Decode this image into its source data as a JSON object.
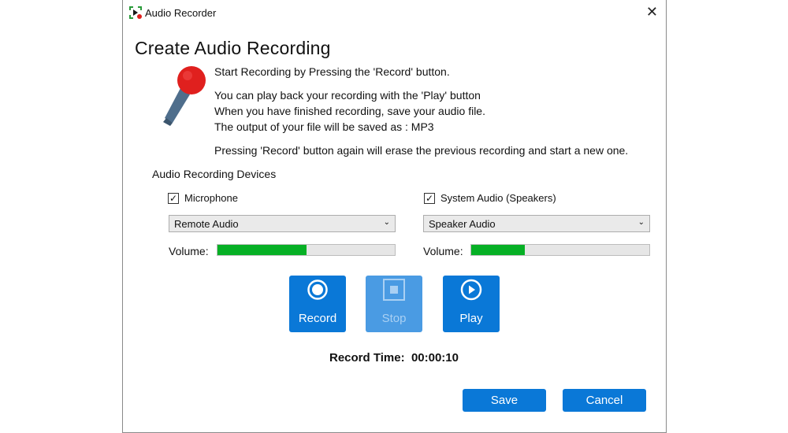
{
  "window": {
    "title": "Audio Recorder",
    "close_icon": "close-icon"
  },
  "heading": "Create Audio Recording",
  "instructions": {
    "line1": "Start Recording  by Pressing the 'Record' button.",
    "line2": "You can play back your recording with the 'Play' button",
    "line3": "When you have finished recording, save your audio file.",
    "line4": "The output of your file will be saved as : MP3",
    "line5": "Pressing 'Record' button again will erase the previous recording and start a new one."
  },
  "devices": {
    "section_label": "Audio Recording Devices",
    "microphone": {
      "label": "Microphone",
      "checked": true,
      "selected": "Remote Audio",
      "volume_label": "Volume:",
      "volume_percent": 50
    },
    "system": {
      "label": "System Audio (Speakers)",
      "checked": true,
      "selected": "Speaker Audio",
      "volume_label": "Volume:",
      "volume_percent": 30
    }
  },
  "controls": {
    "record": {
      "label": "Record",
      "icon": "record-icon",
      "enabled": true
    },
    "stop": {
      "label": "Stop",
      "icon": "stop-icon",
      "enabled": false
    },
    "play": {
      "label": "Play",
      "icon": "play-icon",
      "enabled": true
    }
  },
  "record_time": {
    "label": "Record Time:",
    "value": "00:00:10"
  },
  "footer": {
    "save": "Save",
    "cancel": "Cancel"
  },
  "colors": {
    "accent": "#0a78d7",
    "volume": "#06b025"
  }
}
